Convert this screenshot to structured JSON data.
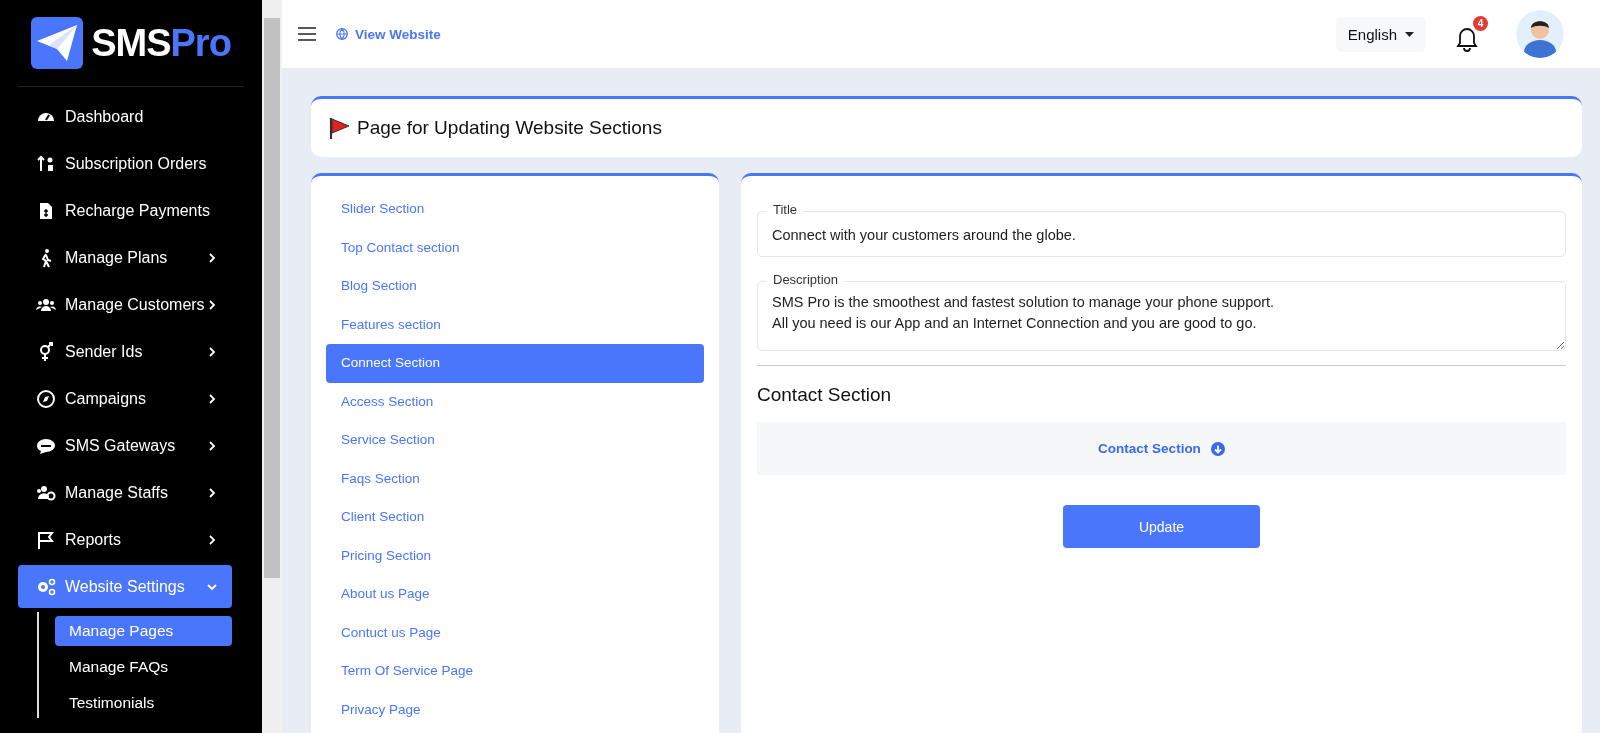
{
  "sidebar": {
    "logo": {
      "primary": "SMS",
      "accent": "Pro"
    },
    "items": [
      {
        "label": "Dashboard",
        "kind": "dashboard",
        "has_submenu": false,
        "selected": false
      },
      {
        "label": "Subscription Orders",
        "kind": "sort",
        "has_submenu": false,
        "selected": false
      },
      {
        "label": "Recharge Payments",
        "kind": "invoice",
        "has_submenu": false,
        "selected": false
      },
      {
        "label": "Manage Plans",
        "kind": "walk",
        "has_submenu": true,
        "expanded": false,
        "selected": false
      },
      {
        "label": "Manage Customers",
        "kind": "users",
        "has_submenu": true,
        "expanded": false,
        "selected": false
      },
      {
        "label": "Sender Ids",
        "kind": "gender",
        "has_submenu": true,
        "expanded": false,
        "selected": false
      },
      {
        "label": "Campaigns",
        "kind": "compass",
        "has_submenu": true,
        "expanded": false,
        "selected": false
      },
      {
        "label": "SMS Gateways",
        "kind": "sms",
        "has_submenu": true,
        "expanded": false,
        "selected": false
      },
      {
        "label": "Manage Staffs",
        "kind": "staff",
        "has_submenu": true,
        "expanded": false,
        "selected": false
      },
      {
        "label": "Reports",
        "kind": "flag",
        "has_submenu": true,
        "expanded": false,
        "selected": false
      },
      {
        "label": "Website Settings",
        "kind": "gears",
        "has_submenu": true,
        "expanded": true,
        "selected": true,
        "children": [
          {
            "label": "Manage Pages",
            "selected": true
          },
          {
            "label": "Manage FAQs",
            "selected": false
          },
          {
            "label": "Testimonials",
            "selected": false
          }
        ]
      }
    ]
  },
  "topbar": {
    "view_website": "View Website",
    "language": "English",
    "notification_count": "4"
  },
  "page_header": {
    "title": "Page for Updating Website Sections"
  },
  "sections": [
    {
      "label": "Slider Section",
      "selected": false
    },
    {
      "label": "Top Contact section",
      "selected": false
    },
    {
      "label": "Blog Section",
      "selected": false
    },
    {
      "label": "Features section",
      "selected": false
    },
    {
      "label": "Connect Section",
      "selected": true
    },
    {
      "label": "Access Section",
      "selected": false
    },
    {
      "label": "Service Section",
      "selected": false
    },
    {
      "label": "Faqs Section",
      "selected": false
    },
    {
      "label": "Client Section",
      "selected": false
    },
    {
      "label": "Pricing Section",
      "selected": false
    },
    {
      "label": "About us Page",
      "selected": false
    },
    {
      "label": "Contuct us Page",
      "selected": false
    },
    {
      "label": "Term Of Service Page",
      "selected": false
    },
    {
      "label": "Privacy Page",
      "selected": false
    }
  ],
  "form": {
    "fields": [
      {
        "label": "Title",
        "kind": "text",
        "value": "Connect with your customers around the globe."
      },
      {
        "label": "Description",
        "kind": "textarea",
        "value": "SMS Pro is the smoothest and fastest solution to manage your phone support.\nAll you need is our App and an Internet Connection and you are good to go."
      }
    ],
    "contact_heading": "Contact Section",
    "accordion": {
      "label": "Contact Section",
      "expanded": false
    },
    "submit": "Update"
  }
}
